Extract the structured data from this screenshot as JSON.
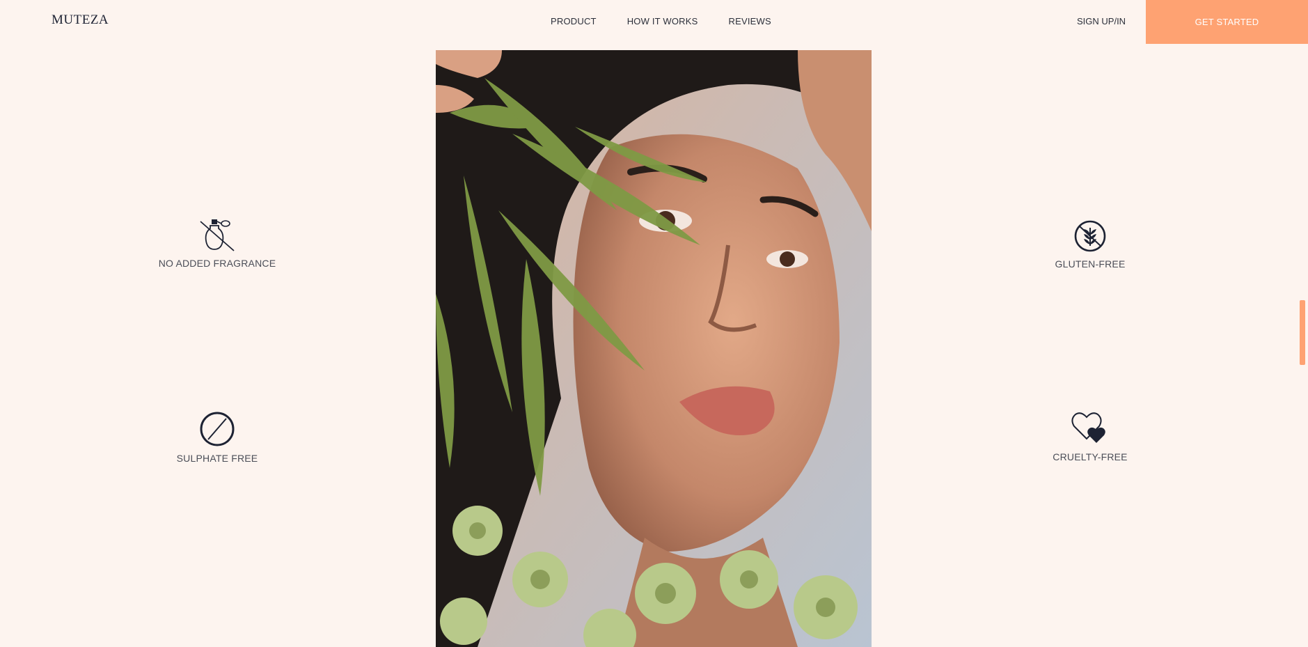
{
  "header": {
    "logo": "MUTEZA",
    "nav": [
      "PRODUCT",
      "HOW IT WORKS",
      "REVIEWS"
    ],
    "signin": "SIGN UP/IN",
    "cta": "GET STARTED"
  },
  "features": {
    "fragrance": {
      "label": "NO ADDED FRAGRANCE",
      "icon": "no-fragrance-icon"
    },
    "sulphate": {
      "label": "SULPHATE FREE",
      "icon": "no-sulphate-icon"
    },
    "gluten": {
      "label": "GLUTEN-FREE",
      "icon": "gluten-free-icon"
    },
    "cruelty": {
      "label": "CRUELTY-FREE",
      "icon": "hearts-icon"
    }
  },
  "colors": {
    "background": "#fdf4ef",
    "accent": "#fea272",
    "ink": "#1d2233"
  }
}
